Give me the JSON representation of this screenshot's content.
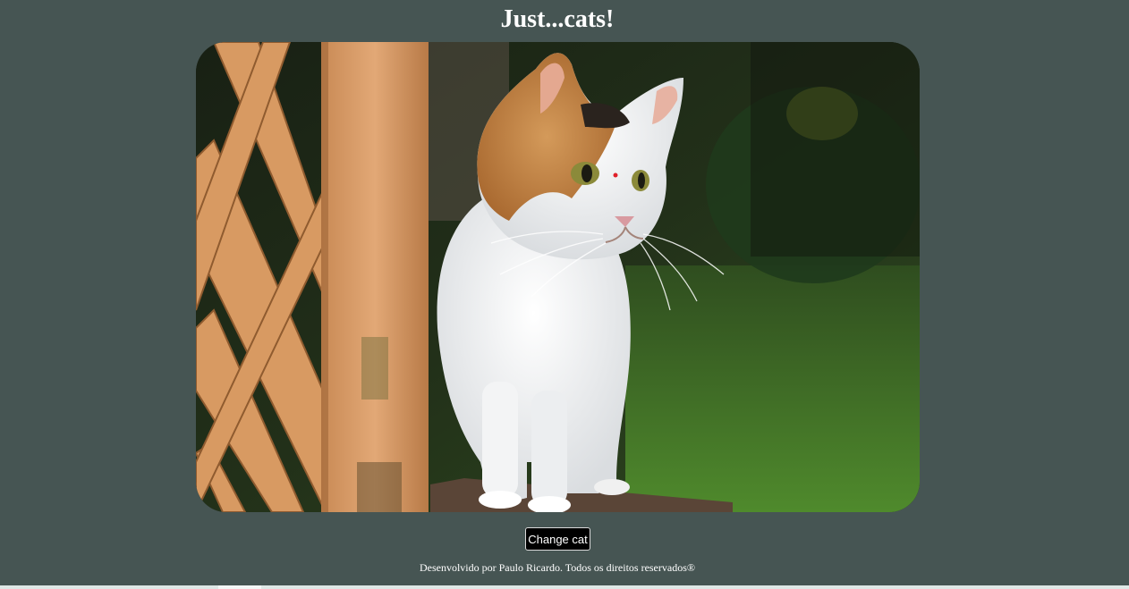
{
  "page": {
    "title": "Just...cats!",
    "background_color": "#465553"
  },
  "cat_image": {
    "alt": "cat",
    "subject_icon": "calico-cat-photo"
  },
  "actions": {
    "change_cat_label": "Change cat"
  },
  "footer": {
    "credit_text": "Desenvolvido por Paulo Ricardo. Todos os direitos reservados®"
  }
}
